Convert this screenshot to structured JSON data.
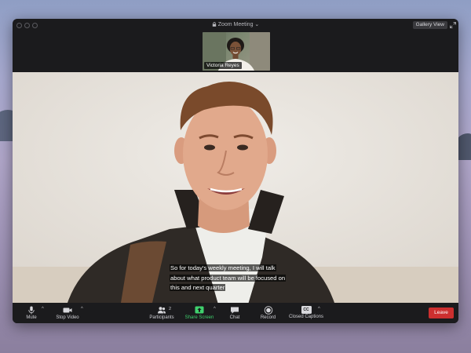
{
  "window": {
    "title": "Zoom Meeting",
    "view_button": "Gallery View"
  },
  "participant_thumbnail": {
    "name": "Victoria Reyes"
  },
  "caption": {
    "line1": "So for today's weekly meeting, I will talk",
    "line2": "about what product team will be focused on",
    "line3": "this and next quarter"
  },
  "toolbar": {
    "mute": "Mute",
    "stop_video": "Stop Video",
    "participants": "Participants",
    "participants_count": "2",
    "share_screen": "Share Screen",
    "chat": "Chat",
    "record": "Record",
    "closed_captions": "Closed Captions",
    "cc_icon_text": "CC",
    "leave": "Leave"
  },
  "colors": {
    "share_green": "#3fd16d",
    "leave_red": "#cc2f2f",
    "window_bg": "#1b1b1d"
  },
  "icons": [
    "lock-icon",
    "fullscreen-icon",
    "microphone-icon",
    "video-camera-icon",
    "participants-icon",
    "share-screen-icon",
    "chat-icon",
    "record-icon",
    "closed-captions-icon"
  ]
}
